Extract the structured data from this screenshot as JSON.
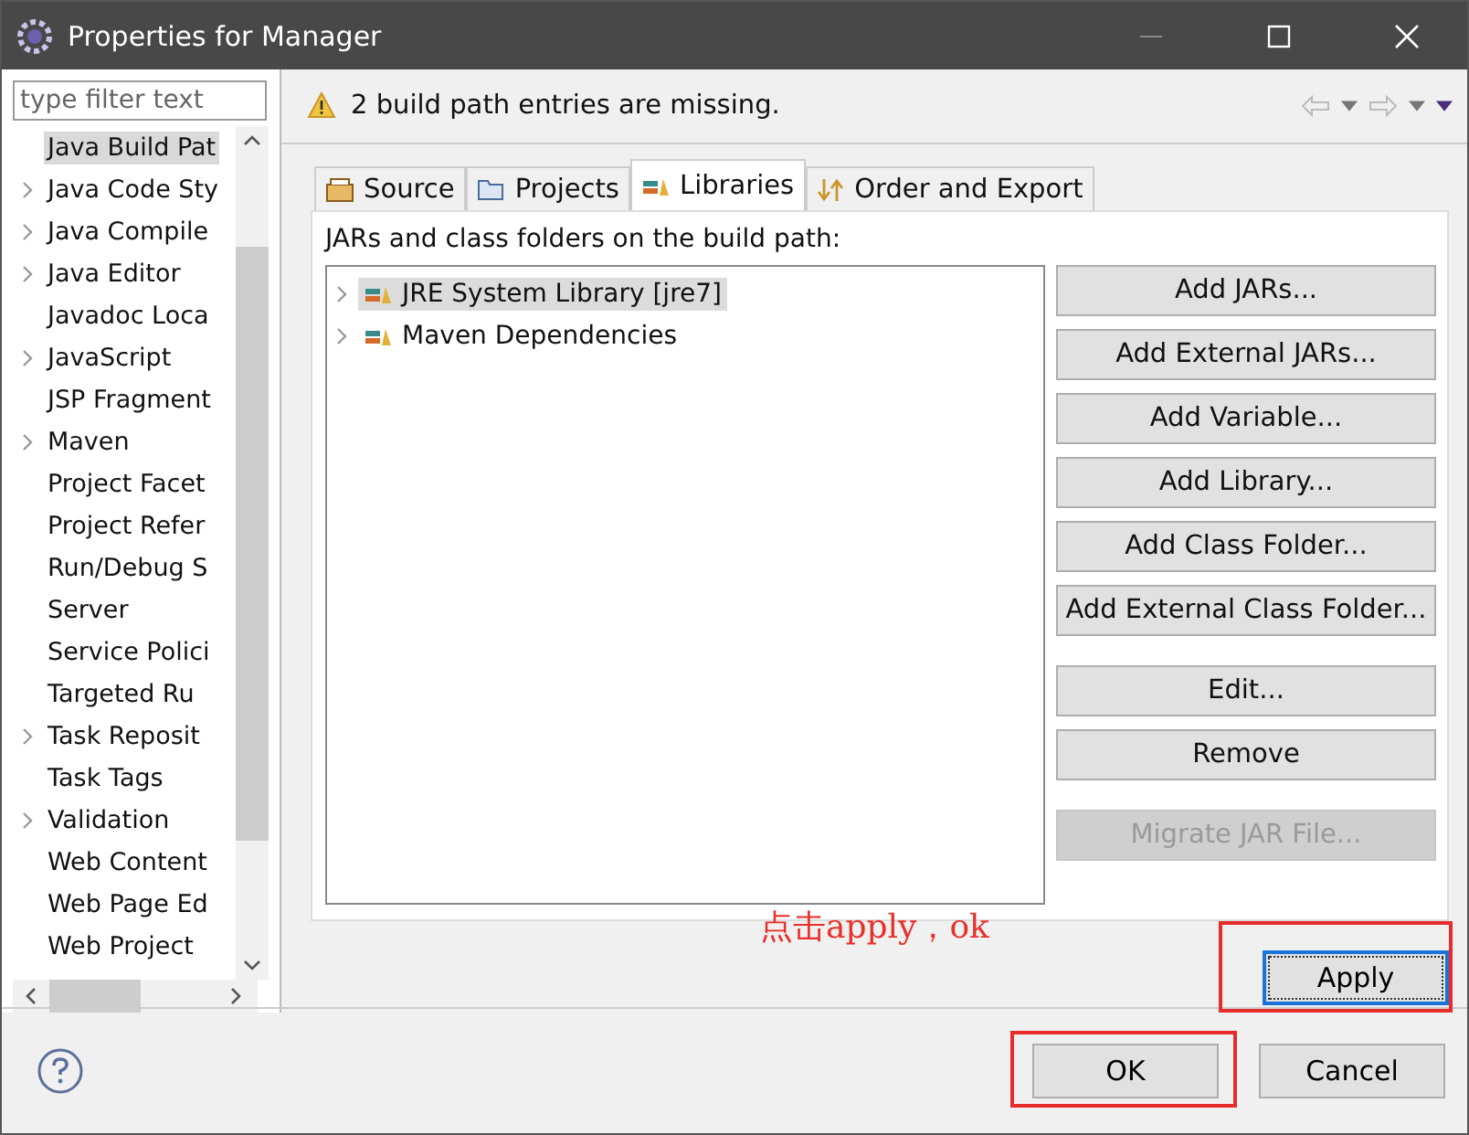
{
  "window": {
    "title": "Properties for Manager"
  },
  "sidebar": {
    "filter_placeholder": "type filter text",
    "items": [
      {
        "label": "Java Build Pat",
        "expandable": false,
        "selected": true
      },
      {
        "label": "Java Code Sty",
        "expandable": true,
        "selected": false
      },
      {
        "label": "Java Compile",
        "expandable": true,
        "selected": false
      },
      {
        "label": "Java Editor",
        "expandable": true,
        "selected": false
      },
      {
        "label": "Javadoc Loca",
        "expandable": false,
        "selected": false
      },
      {
        "label": "JavaScript",
        "expandable": true,
        "selected": false
      },
      {
        "label": "JSP Fragment",
        "expandable": false,
        "selected": false
      },
      {
        "label": "Maven",
        "expandable": true,
        "selected": false
      },
      {
        "label": "Project Facet",
        "expandable": false,
        "selected": false
      },
      {
        "label": "Project Refer",
        "expandable": false,
        "selected": false
      },
      {
        "label": "Run/Debug S",
        "expandable": false,
        "selected": false
      },
      {
        "label": "Server",
        "expandable": false,
        "selected": false
      },
      {
        "label": "Service Polici",
        "expandable": false,
        "selected": false
      },
      {
        "label": "Targeted Ru",
        "expandable": false,
        "selected": false
      },
      {
        "label": "Task Reposit",
        "expandable": true,
        "selected": false
      },
      {
        "label": "Task Tags",
        "expandable": false,
        "selected": false
      },
      {
        "label": "Validation",
        "expandable": true,
        "selected": false
      },
      {
        "label": "Web Content",
        "expandable": false,
        "selected": false
      },
      {
        "label": "Web Page Ed",
        "expandable": false,
        "selected": false
      },
      {
        "label": "Web Project",
        "expandable": false,
        "selected": false
      }
    ]
  },
  "message": "2 build path entries are missing.",
  "tabs": [
    {
      "label": "Source",
      "kind": "source",
      "selected": false
    },
    {
      "label": "Projects",
      "kind": "projects",
      "selected": false
    },
    {
      "label": "Libraries",
      "kind": "libraries",
      "selected": true
    },
    {
      "label": "Order and Export",
      "kind": "order",
      "selected": false
    }
  ],
  "list_label": "JARs and class folders on the build path:",
  "libraries": [
    {
      "label": "JRE System Library [jre7]",
      "selected": true
    },
    {
      "label": "Maven Dependencies",
      "selected": false
    }
  ],
  "button_groups": [
    {
      "buttons": [
        {
          "label": "Add JARs...",
          "disabled": false
        },
        {
          "label": "Add External JARs...",
          "disabled": false
        },
        {
          "label": "Add Variable...",
          "disabled": false
        },
        {
          "label": "Add Library...",
          "disabled": false
        },
        {
          "label": "Add Class Folder...",
          "disabled": false
        },
        {
          "label": "Add External Class Folder...",
          "disabled": false
        }
      ]
    },
    {
      "buttons": [
        {
          "label": "Edit...",
          "disabled": false
        },
        {
          "label": "Remove",
          "disabled": false
        }
      ]
    },
    {
      "buttons": [
        {
          "label": "Migrate JAR File...",
          "disabled": true
        }
      ]
    }
  ],
  "annotation": "点击apply，ok",
  "apply_button": "Apply",
  "ok_button": "OK",
  "cancel_button": "Cancel"
}
